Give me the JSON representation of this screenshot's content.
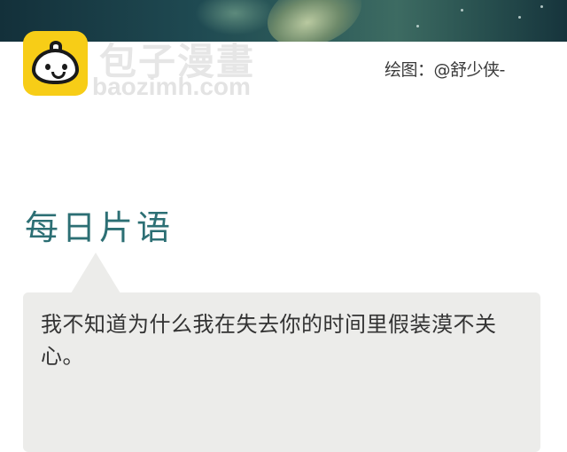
{
  "watermark": {
    "title": "包子漫畫",
    "url": "baozimh.com"
  },
  "credit": {
    "text": "绘图：@舒少侠-"
  },
  "section": {
    "heading": "每日片语"
  },
  "quote": {
    "text": "我不知道为什么我在失去你的时间里假装漠不关心。"
  },
  "colors": {
    "logo_yellow": "#f7cd17",
    "heading_teal": "#2c6f74",
    "bubble_gray": "#ececea"
  },
  "icons": {
    "logo": "bun-mascot-icon"
  }
}
